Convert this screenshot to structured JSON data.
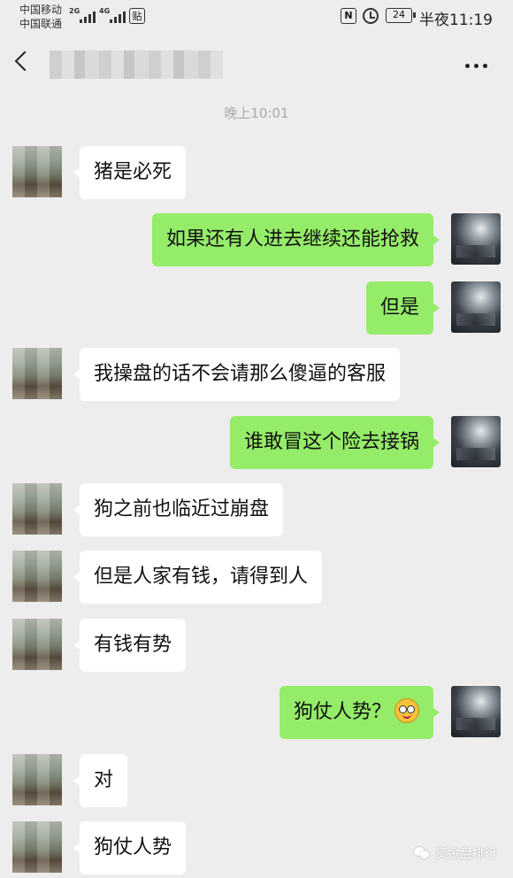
{
  "status_bar": {
    "carrier1": "中国移动",
    "carrier2": "中国联通",
    "net1": "2G",
    "net2": "4G",
    "tie_label": "贴",
    "battery": "24",
    "time": "半夜11:19"
  },
  "header": {
    "more_icon": "more-icon"
  },
  "timestamp": "晚上10:01",
  "messages": [
    {
      "from": "other",
      "text": "猪是必死"
    },
    {
      "from": "self",
      "text": "如果还有人进去继续还能抢救"
    },
    {
      "from": "self",
      "text": "但是"
    },
    {
      "from": "other",
      "text": "我操盘的话不会请那么傻逼的客服"
    },
    {
      "from": "self",
      "text": "谁敢冒这个险去接锅"
    },
    {
      "from": "other",
      "text": "狗之前也临近过崩盘"
    },
    {
      "from": "other",
      "text": "但是人家有钱，请得到人"
    },
    {
      "from": "other",
      "text": "有钱有势"
    },
    {
      "from": "self",
      "text": "狗仗人势？"
    },
    {
      "from": "other",
      "text": "对"
    },
    {
      "from": "other",
      "text": "狗仗人势"
    }
  ],
  "watermark": "资金盘排行"
}
